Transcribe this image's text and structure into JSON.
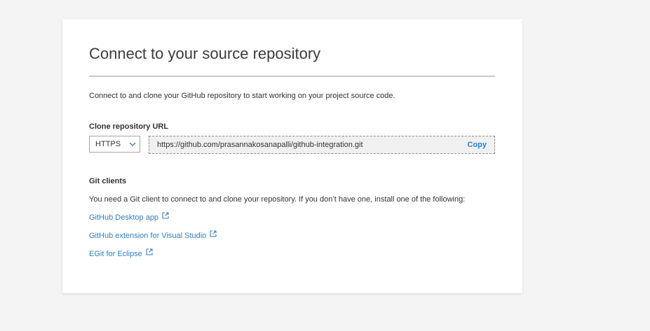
{
  "page": {
    "title": "Connect to your source repository",
    "description": "Connect to and clone your GitHub repository to start working on your project source code."
  },
  "clone": {
    "label": "Clone repository URL",
    "protocol": "HTTPS",
    "url": "https://github.com/prasannakosanapalli/github-integration.git",
    "copy_label": "Copy"
  },
  "git_clients": {
    "heading": "Git clients",
    "description": "You need a Git client to connect to and clone your repository. If you don’t have one, install one of the following:",
    "links": [
      {
        "label": "GitHub Desktop app",
        "icon": "external-link-icon"
      },
      {
        "label": "GitHub extension for Visual Studio",
        "icon": "external-link-icon"
      },
      {
        "label": "EGit for Eclipse",
        "icon": "external-link-icon"
      }
    ]
  },
  "colors": {
    "link": "#2e7fc0",
    "background": "#f4f4f4",
    "card": "#ffffff"
  }
}
